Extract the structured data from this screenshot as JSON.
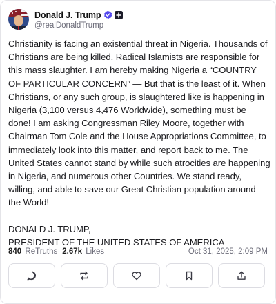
{
  "author": {
    "display_name": "Donald J. Trump",
    "handle": "@realDonaldTrump",
    "verified": true
  },
  "post": {
    "paragraphs": [
      "Christianity is facing an existential threat in Nigeria. Thousands of Christians are being killed. Radical Islamists are responsible for this mass slaughter. I am hereby making Nigeria a “COUNTRY OF PARTICULAR CONCERN” — But that is the least of it. When Christians, or any such group, is slaughtered like is happening in Nigeria (3,100 versus 4,476 Worldwide), something must be done! I am asking Congressman Riley Moore, together with Chairman Tom Cole and the House Appropriations Committee, to immediately look into this matter, and report back to me. The United States cannot stand by while such atrocities are happening in Nigeria, and numerous other Countries. We stand ready, willing, and able to save our Great Christian population around the World!",
      "DONALD J. TRUMP,\nPRESIDENT OF THE UNITED STATES OF AMERICA"
    ]
  },
  "stats": {
    "retruths_count": "840",
    "retruths_label": "ReTruths",
    "likes_count": "2.67k",
    "likes_label": "Likes"
  },
  "timestamp": "Oct 31, 2025, 2:09 PM",
  "actions": [
    {
      "name": "reply",
      "icon": "reply-icon"
    },
    {
      "name": "retruth",
      "icon": "retruth-icon"
    },
    {
      "name": "like",
      "icon": "heart-icon"
    },
    {
      "name": "bookmark",
      "icon": "bookmark-icon"
    },
    {
      "name": "share",
      "icon": "share-icon"
    }
  ],
  "colors": {
    "verified_badge": "#5448ee",
    "border": "#e4e4e8",
    "muted_text": "#6b6b78"
  }
}
